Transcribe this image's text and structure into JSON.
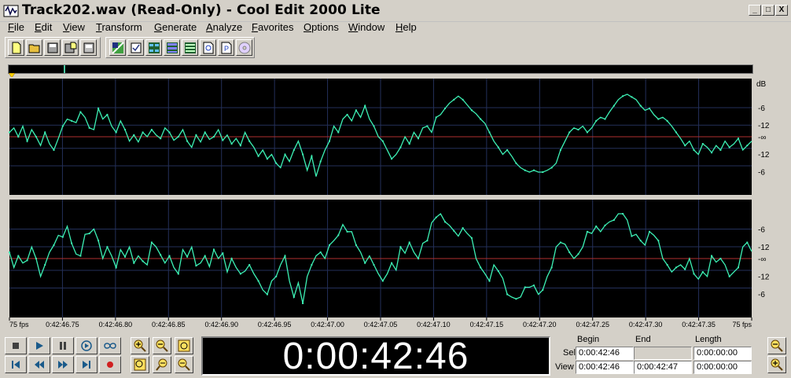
{
  "window": {
    "title": "Track202.wav (Read-Only) - Cool Edit 2000 Lite",
    "minimize_glyph": "_",
    "maximize_glyph": "□",
    "close_glyph": "X"
  },
  "menu": {
    "items": [
      {
        "label": "File",
        "key": "F",
        "rest": "ile"
      },
      {
        "label": "Edit",
        "key": "E",
        "rest": "dit"
      },
      {
        "label": "View",
        "key": "V",
        "rest": "iew"
      },
      {
        "label": "Transform",
        "key": "T",
        "rest": "ransform"
      },
      {
        "label": "Generate",
        "key": "G",
        "rest": "enerate"
      },
      {
        "label": "Analyze",
        "key": "A",
        "rest": "nalyze"
      },
      {
        "label": "Favorites",
        "key": "F",
        "rest": "avorites"
      },
      {
        "label": "Options",
        "key": "O",
        "rest": "ptions"
      },
      {
        "label": "Window",
        "key": "W",
        "rest": "indow"
      },
      {
        "label": "Help",
        "key": "H",
        "rest": "elp"
      }
    ]
  },
  "toolbar": {
    "file_buttons": [
      "new-file-icon",
      "open-file-icon",
      "save-file-icon",
      "save-as-icon",
      "close-file-icon"
    ],
    "tool_buttons": [
      "mix-icon",
      "check-icon",
      "spectral-icon",
      "multitrack-icon",
      "cue-list-icon",
      "zoom-page-icon",
      "properties-icon",
      "cd-icon"
    ]
  },
  "waveform": {
    "db_label": "dB",
    "top_channel_scale": [
      "-6",
      "-12",
      "-∞",
      "-12",
      "-6"
    ],
    "bottom_channel_scale": [
      "-6",
      "-12",
      "-∞",
      "-12",
      "-6"
    ],
    "time_ruler": [
      "75 fps",
      "0:42:46.75",
      "0:42:46.80",
      "0:42:46.85",
      "0:42:46.90",
      "0:42:46.95",
      "0:42:47.00",
      "0:42:47.05",
      "0:42:47.10",
      "0:42:47.15",
      "0:42:47.20",
      "0:42:47.25",
      "0:42:47.30",
      "0:42:47.35",
      "75 fps"
    ],
    "colors": {
      "background": "#000000",
      "wave": "#3cf0b4",
      "centerline": "#b03030",
      "grid": "#24305a"
    },
    "top_channel_levels": [
      0.55,
      0.6,
      0.5,
      0.62,
      0.45,
      0.58,
      0.5,
      0.4,
      0.55,
      0.42,
      0.35,
      0.48,
      0.62,
      0.7,
      0.68,
      0.66,
      0.78,
      0.72,
      0.6,
      0.58,
      0.82,
      0.7,
      0.75,
      0.62,
      0.55,
      0.68,
      0.58,
      0.45,
      0.52,
      0.44,
      0.55,
      0.5,
      0.58,
      0.52,
      0.48,
      0.6,
      0.55,
      0.46,
      0.5,
      0.58,
      0.45,
      0.38,
      0.52,
      0.44,
      0.55,
      0.47,
      0.5,
      0.58,
      0.46,
      0.52,
      0.42,
      0.48,
      0.4,
      0.55,
      0.45,
      0.38,
      0.28,
      0.35,
      0.25,
      0.3,
      0.2,
      0.15,
      0.3,
      0.22,
      0.35,
      0.45,
      0.3,
      0.12,
      0.28,
      0.05,
      0.22,
      0.35,
      0.45,
      0.62,
      0.55,
      0.7,
      0.75,
      0.68,
      0.8,
      0.72,
      0.85,
      0.7,
      0.62,
      0.5,
      0.45,
      0.35,
      0.25,
      0.3,
      0.38,
      0.5,
      0.42,
      0.55,
      0.48,
      0.6,
      0.62,
      0.55,
      0.72,
      0.75,
      0.82,
      0.88,
      0.92,
      0.96,
      0.92,
      0.86,
      0.8,
      0.76,
      0.7,
      0.65,
      0.55,
      0.45,
      0.38,
      0.3,
      0.35,
      0.28,
      0.2,
      0.15,
      0.12,
      0.1,
      0.12,
      0.1,
      0.1,
      0.12,
      0.15,
      0.2,
      0.35,
      0.45,
      0.55,
      0.6,
      0.58,
      0.62,
      0.55,
      0.6,
      0.68,
      0.72,
      0.7,
      0.78,
      0.85,
      0.92,
      0.96,
      0.98,
      0.95,
      0.92,
      0.85,
      0.8,
      0.82,
      0.75,
      0.7,
      0.72,
      0.68,
      0.62,
      0.55,
      0.48,
      0.4,
      0.45,
      0.35,
      0.3,
      0.42,
      0.38,
      0.32,
      0.4,
      0.35,
      0.45,
      0.38,
      0.42,
      0.48,
      0.35,
      0.4,
      0.45
    ]
  },
  "transport": {
    "row1": [
      "stop-icon",
      "play-icon",
      "pause-icon",
      "play-to-end-icon",
      "loop-icon"
    ],
    "row2": [
      "go-to-start-icon",
      "rewind-icon",
      "fast-forward-icon",
      "go-to-end-icon",
      "record-icon"
    ]
  },
  "zoom": {
    "row1": [
      "zoom-in-icon",
      "zoom-out-icon",
      "zoom-full-icon"
    ],
    "row2": [
      "zoom-selection-icon",
      "zoom-left-icon",
      "zoom-right-icon"
    ],
    "vertical": [
      "zoom-out-vertical-icon",
      "zoom-in-vertical-icon"
    ]
  },
  "time_display": "0:00:42:46",
  "selection_panel": {
    "col_begin": "Begin",
    "col_end": "End",
    "col_length": "Length",
    "row_sel": "Sel",
    "row_view": "View",
    "sel_begin": "0:00:42:46",
    "sel_end": "",
    "sel_length": "0:00:00:00",
    "view_begin": "0:00:42:46",
    "view_end": "0:00:42:47",
    "view_length": "0:00:00:00"
  }
}
